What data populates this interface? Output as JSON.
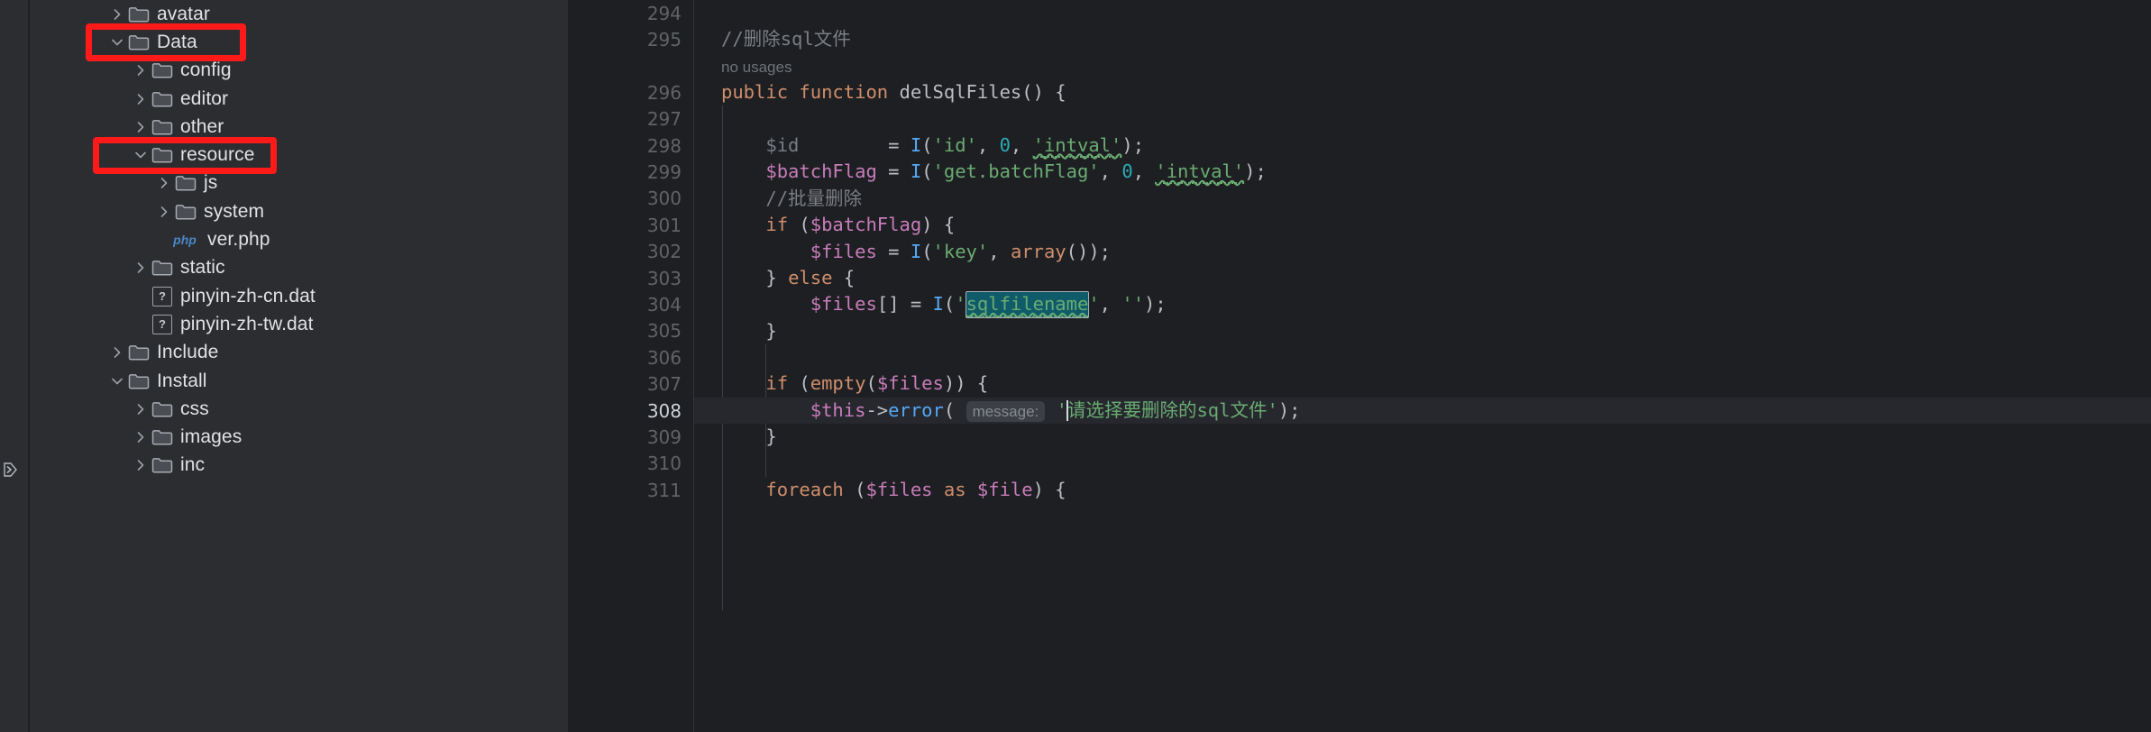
{
  "theme": {
    "sidebar_bg": "#2b2d30",
    "editor_bg": "#1e1f22",
    "annotation_color": "#ff1a1a",
    "current_line_bg": "#26282e",
    "selection_bg": "#0f5b69"
  },
  "sidebar": {
    "expand_icon": "chevron-double-right-icon",
    "items": [
      {
        "label": "avatar",
        "indent": 1,
        "chevron": "right",
        "icon": "folder-icon",
        "annotated": false
      },
      {
        "label": "Data",
        "indent": 1,
        "chevron": "down",
        "icon": "folder-icon",
        "annotated": true
      },
      {
        "label": "config",
        "indent": 2,
        "chevron": "right",
        "icon": "folder-icon",
        "annotated": false
      },
      {
        "label": "editor",
        "indent": 2,
        "chevron": "right",
        "icon": "folder-icon",
        "annotated": false
      },
      {
        "label": "other",
        "indent": 2,
        "chevron": "right",
        "icon": "folder-icon",
        "annotated": false
      },
      {
        "label": "resource",
        "indent": 2,
        "chevron": "down",
        "icon": "folder-icon",
        "annotated": true
      },
      {
        "label": "js",
        "indent": 3,
        "chevron": "right",
        "icon": "folder-icon",
        "annotated": false
      },
      {
        "label": "system",
        "indent": 3,
        "chevron": "right",
        "icon": "folder-icon",
        "annotated": false
      },
      {
        "label": "ver.php",
        "indent": 3,
        "chevron": "none",
        "icon": "php-file-icon",
        "annotated": false
      },
      {
        "label": "static",
        "indent": 2,
        "chevron": "right",
        "icon": "folder-icon",
        "annotated": false
      },
      {
        "label": "pinyin-zh-cn.dat",
        "indent": 2,
        "chevron": "none",
        "icon": "unknown-file-icon",
        "annotated": false
      },
      {
        "label": "pinyin-zh-tw.dat",
        "indent": 2,
        "chevron": "none",
        "icon": "unknown-file-icon",
        "annotated": false
      },
      {
        "label": "Include",
        "indent": 1,
        "chevron": "right",
        "icon": "folder-icon",
        "annotated": false
      },
      {
        "label": "Install",
        "indent": 1,
        "chevron": "down",
        "icon": "folder-icon",
        "annotated": false
      },
      {
        "label": "css",
        "indent": 2,
        "chevron": "right",
        "icon": "folder-icon",
        "annotated": false
      },
      {
        "label": "images",
        "indent": 2,
        "chevron": "right",
        "icon": "folder-icon",
        "annotated": false
      },
      {
        "label": "inc",
        "indent": 2,
        "chevron": "right",
        "icon": "folder-icon",
        "annotated": false
      }
    ]
  },
  "editor": {
    "php_file_badge": "php",
    "unknown_file_badge": "?",
    "inlay_no_usages": "no usages",
    "inlay_param_message": "message:",
    "current_line_number": 308,
    "gutter": [
      {
        "num": "294",
        "fold": ""
      },
      {
        "num": "295",
        "fold": ""
      },
      {
        "num": "",
        "fold": ""
      },
      {
        "num": "296",
        "fold": "down"
      },
      {
        "num": "297",
        "fold": ""
      },
      {
        "num": "298",
        "fold": ""
      },
      {
        "num": "299",
        "fold": ""
      },
      {
        "num": "300",
        "fold": ""
      },
      {
        "num": "301",
        "fold": "down"
      },
      {
        "num": "302",
        "fold": ""
      },
      {
        "num": "303",
        "fold": ""
      },
      {
        "num": "304",
        "fold": ""
      },
      {
        "num": "305",
        "fold": ""
      },
      {
        "num": "306",
        "fold": ""
      },
      {
        "num": "307",
        "fold": "down"
      },
      {
        "num": "308",
        "fold": ""
      },
      {
        "num": "309",
        "fold": ""
      },
      {
        "num": "310",
        "fold": ""
      },
      {
        "num": "311",
        "fold": ""
      }
    ],
    "code_lines": [
      "",
      "//删除sql文件",
      "no usages",
      "public function delSqlFiles() {",
      "",
      "    $id        = I('id', 0, 'intval');",
      "    $batchFlag = I('get.batchFlag', 0, 'intval');",
      "    //批量删除",
      "    if ($batchFlag) {",
      "        $files = I('key', array());",
      "    } else {",
      "        $files[] = I('sqlfilename', '');",
      "    }",
      "",
      "    if (empty($files)) {",
      "        $this->error( message: '请选择要删除的sql文件');",
      "    }",
      "",
      "    foreach ($files as $file) {"
    ],
    "tokens": {
      "comment_delete_sql": "//删除sql文件",
      "comment_batch_delete": "//批量删除",
      "kw_public": "public",
      "kw_function": "function",
      "fn_name": "delSqlFiles",
      "var_id": "$id",
      "var_batchFlag": "$batchFlag",
      "var_files": "$files",
      "var_this": "$this",
      "var_file": "$file",
      "fn_I": "I",
      "fn_array": "array",
      "fn_empty": "empty",
      "fn_error": "error",
      "kw_if": "if",
      "kw_else": "else",
      "kw_foreach": "foreach",
      "kw_as": "as",
      "str_id": "'id'",
      "str_intval": "'intval'",
      "str_getBatchFlag": "'get.batchFlag'",
      "str_key": "'key'",
      "str_sqlfilename": "sqlfilename",
      "str_empty": "''",
      "str_error_msg": "请选择要删除的sql文件",
      "num_zero": "0"
    }
  }
}
